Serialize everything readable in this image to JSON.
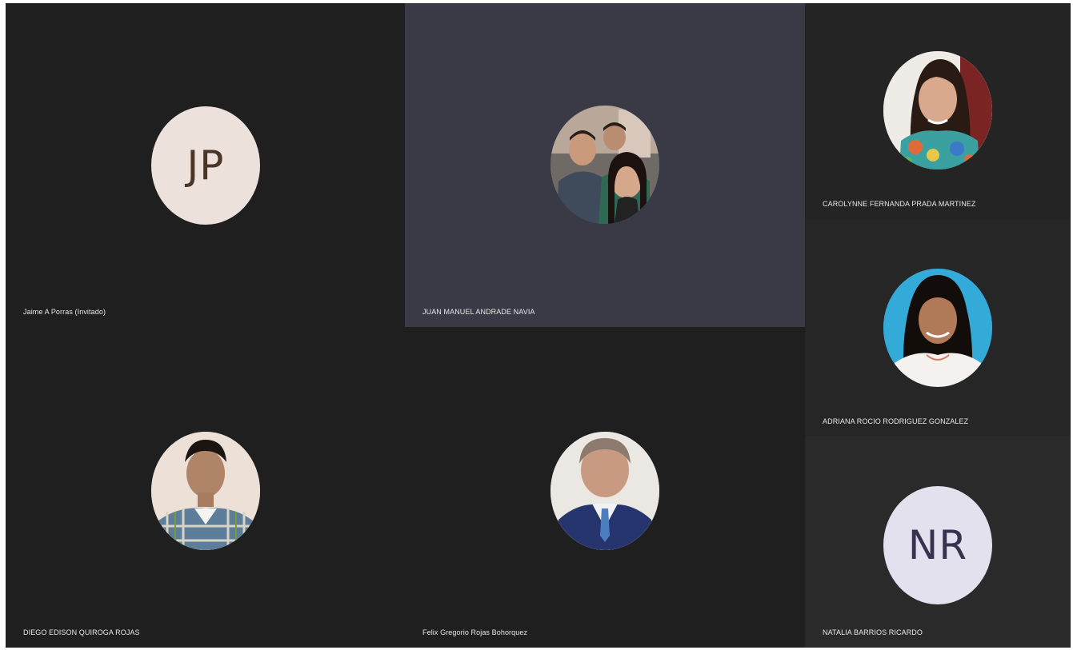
{
  "participants": [
    {
      "name": "Jaime A Porras (Invitado)",
      "initials": "JP",
      "avatar_bg": "#ede1dc",
      "initials_color": "#4a3628"
    },
    {
      "name": "JUAN MANUEL ANDRADE NAVIA",
      "avatar": "photo-group-icon"
    },
    {
      "name": "CAROLYNNE FERNANDA PRADA MARTINEZ",
      "avatar": "photo-woman-icon"
    },
    {
      "name": "ADRIANA ROCIO RODRIGUEZ GONZALEZ",
      "avatar": "photo-woman-blue-icon"
    },
    {
      "name": "DIEGO EDISON QUIROGA ROJAS",
      "avatar": "photo-man-plaid-icon"
    },
    {
      "name": "Felix Gregorio Rojas Bohorquez",
      "avatar": "photo-man-suit-icon"
    },
    {
      "name": "NATALIA BARRIOS RICARDO",
      "initials": "NR",
      "avatar_bg": "#e4e1ef",
      "initials_color": "#39324f"
    }
  ],
  "colors": {
    "tile_bg": "#1f1f1f",
    "active_tile_bg": "#3a3a46",
    "name_text": "#e8e8e8"
  }
}
